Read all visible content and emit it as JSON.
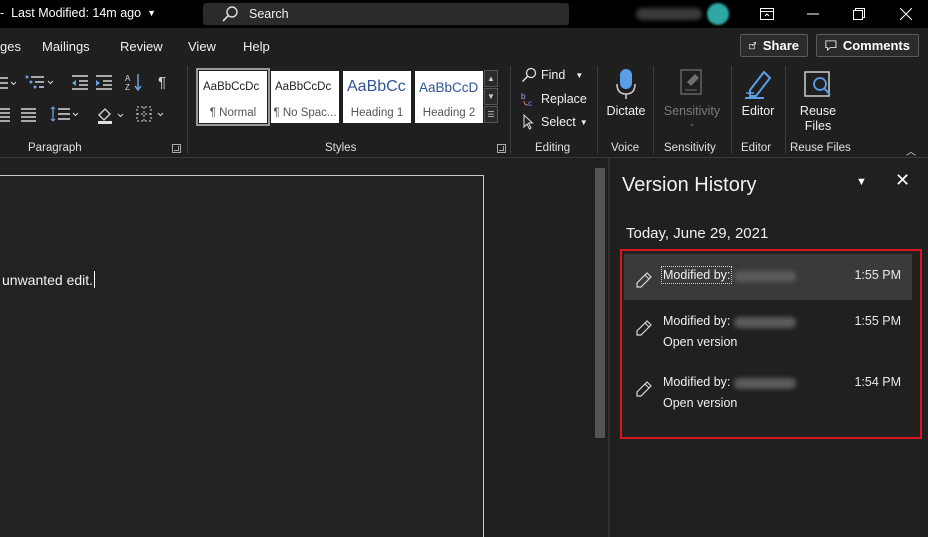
{
  "titlebar": {
    "last_modified": "Last Modified: 14m ago",
    "search_placeholder": "Search"
  },
  "tabs": [
    {
      "label": "ges"
    },
    {
      "label": "Mailings"
    },
    {
      "label": "Review"
    },
    {
      "label": "View"
    },
    {
      "label": "Help"
    }
  ],
  "actions": {
    "share": "Share",
    "comments": "Comments"
  },
  "ribbon": {
    "groups": {
      "paragraph": "Paragraph",
      "styles": "Styles",
      "editing": "Editing",
      "voice": "Voice",
      "sensitivity": "Sensitivity",
      "editor": "Editor",
      "reuse_files": "Reuse Files"
    },
    "styles": [
      {
        "sample": "AaBbCcDc",
        "name": "¶ Normal"
      },
      {
        "sample": "AaBbCcDc",
        "name": "¶ No Spac..."
      },
      {
        "sample": "AaBbCc",
        "name": "Heading 1"
      },
      {
        "sample": "AaBbCcD",
        "name": "Heading 2"
      }
    ],
    "editing": {
      "find": "Find",
      "replace": "Replace",
      "select": "Select"
    },
    "buttons": {
      "dictate": "Dictate",
      "sensitivity": "Sensitivity",
      "editor": "Editor",
      "reuse_line1": "Reuse",
      "reuse_line2": "Files"
    }
  },
  "document": {
    "text": "unwanted edit."
  },
  "version_history": {
    "title": "Version History",
    "date": "Today, June 29, 2021",
    "versions": [
      {
        "modified_by": "Modified by:",
        "time": "1:55 PM",
        "open": ""
      },
      {
        "modified_by": "Modified by:",
        "time": "1:55 PM",
        "open": "Open version"
      },
      {
        "modified_by": "Modified by:",
        "time": "1:54 PM",
        "open": "Open version"
      }
    ]
  },
  "colors": {
    "highlight_box": "#d9141f",
    "background": "#1f1f1f",
    "titlebar": "#000000"
  }
}
